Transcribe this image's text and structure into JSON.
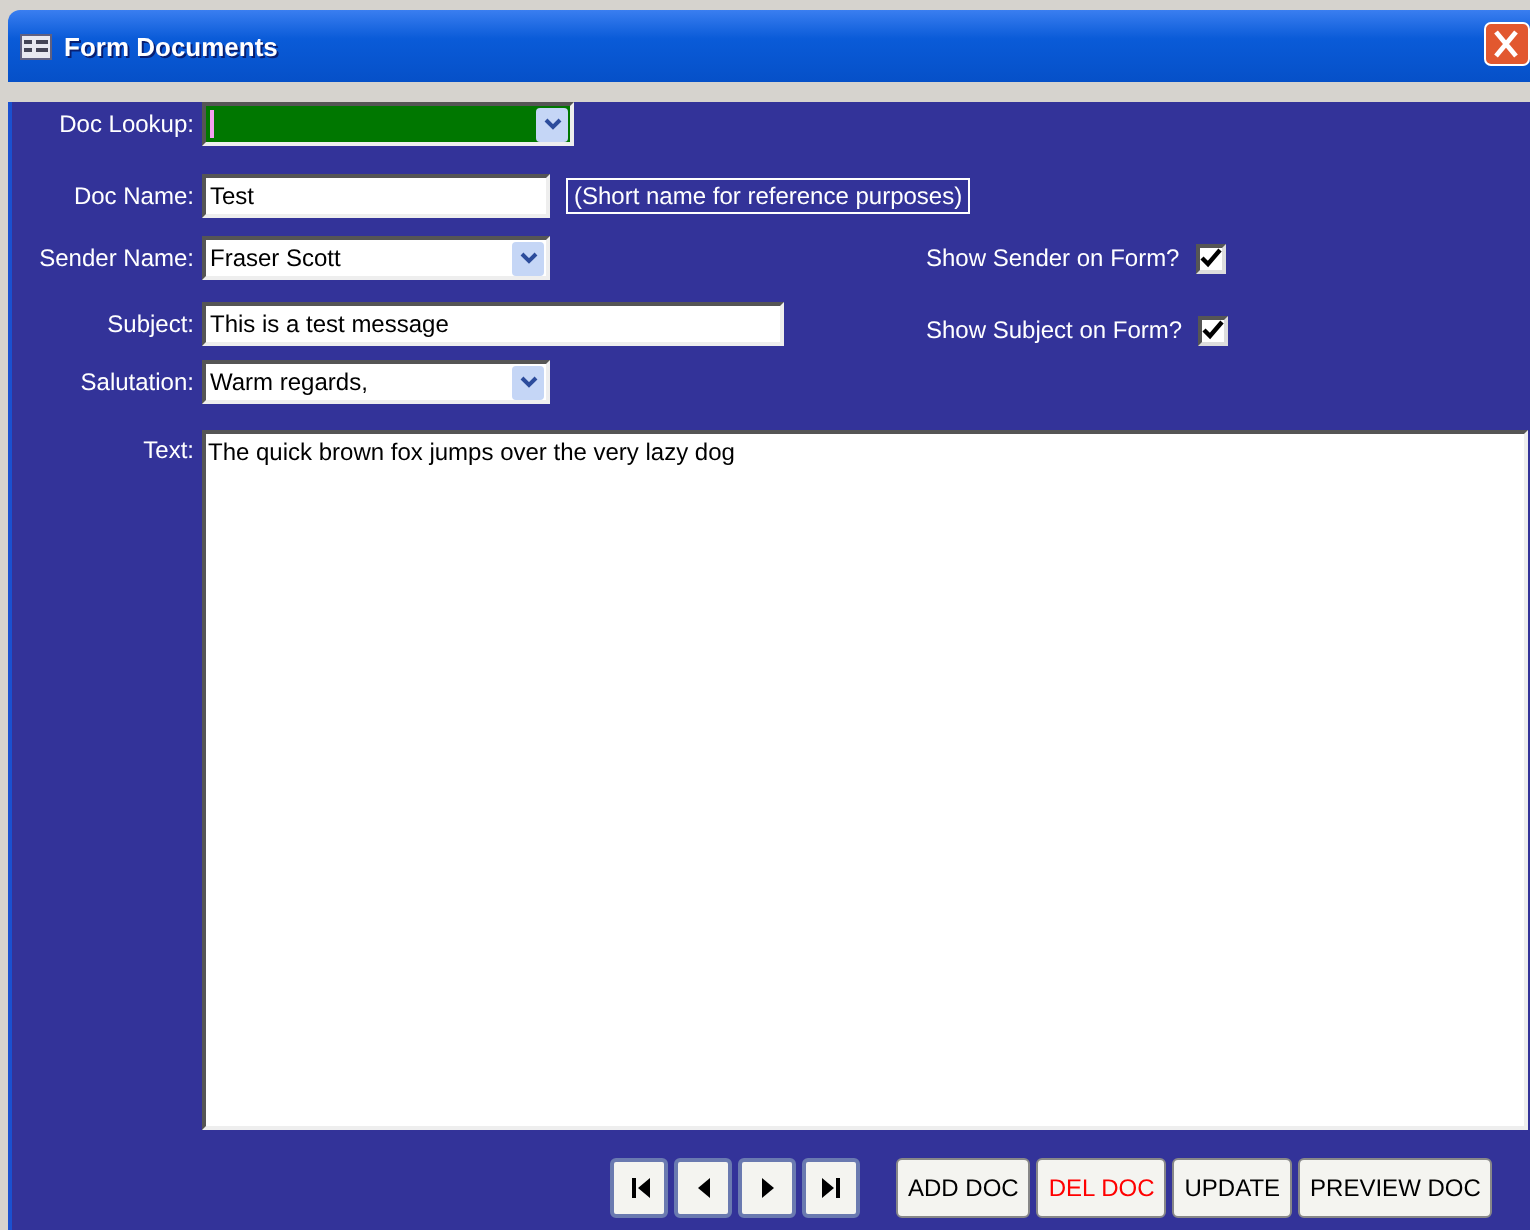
{
  "window": {
    "title": "Form Documents"
  },
  "fields": [
    {
      "label": "Doc Lookup:",
      "kind": "combo",
      "focused": true
    },
    {
      "label": "Doc Name:",
      "kind": "text",
      "focused": false,
      "value": "Test",
      "hint": "(Short name for reference purposes)"
    },
    {
      "label": "Sender Name:",
      "kind": "combo",
      "focused": false,
      "value": "Fraser Scott",
      "option": {
        "label": "Show Sender on Form?",
        "checked": true
      }
    },
    {
      "label": "Subject:",
      "kind": "text",
      "focused": false,
      "value": "This is a test message",
      "option": {
        "label": "Show Subject on Form?",
        "checked": true
      }
    },
    {
      "label": "Salutation:",
      "kind": "combo",
      "focused": false,
      "value": "Warm regards,"
    }
  ],
  "text": {
    "label": "Text:",
    "value": "The quick brown fox jumps over the very lazy dog"
  },
  "navigation": [
    {
      "kind": "first"
    },
    {
      "kind": "previous"
    },
    {
      "kind": "next"
    },
    {
      "kind": "last"
    }
  ],
  "buttons": [
    {
      "label": "ADD DOC",
      "kind": "normal"
    },
    {
      "label": "DEL DOC",
      "kind": "danger"
    },
    {
      "label": "UPDATE",
      "kind": "normal"
    },
    {
      "label": "PREVIEW DOC",
      "kind": "normal"
    }
  ]
}
